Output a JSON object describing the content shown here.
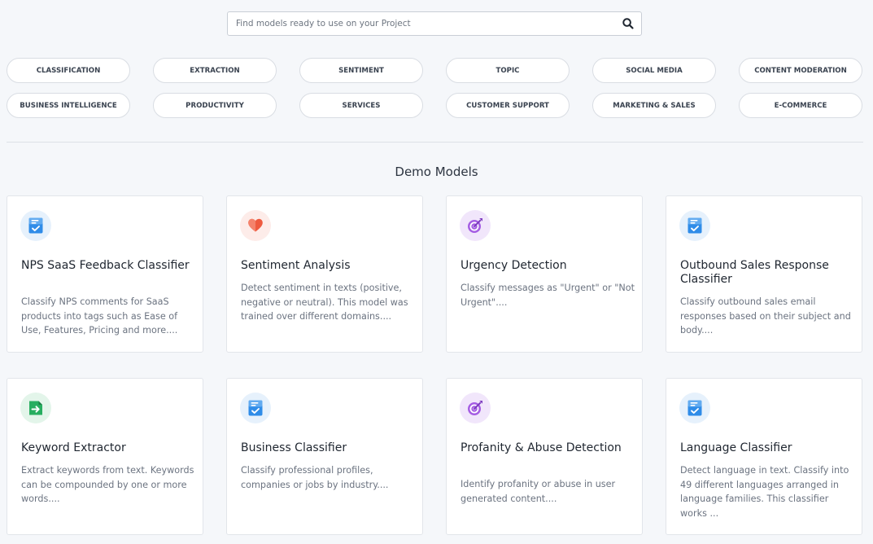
{
  "search": {
    "placeholder": "Find models ready to use on your Project",
    "value": ""
  },
  "categories": [
    "CLASSIFICATION",
    "EXTRACTION",
    "SENTIMENT",
    "TOPIC",
    "SOCIAL MEDIA",
    "CONTENT MODERATION",
    "BUSINESS INTELLIGENCE",
    "PRODUCTIVITY",
    "SERVICES",
    "CUSTOMER SUPPORT",
    "MARKETING & SALES",
    "E-COMMERCE"
  ],
  "section": {
    "title": "Demo Models"
  },
  "colors": {
    "icon_blue": "#2f8ce8",
    "icon_red": "#ee5a3f",
    "icon_purple": "#a55de3",
    "icon_green": "#27ae60"
  },
  "models": [
    {
      "title": "NPS SaaS Feedback Classifier",
      "description": "Classify NPS comments for SaaS products into tags such as Ease of Use, Features, Pricing and more....",
      "icon": "classifier-icon"
    },
    {
      "title": "Sentiment Analysis",
      "description": "Detect sentiment in texts (positive, negative or neutral). This model was trained over different domains....",
      "icon": "heart-icon"
    },
    {
      "title": "Urgency Detection",
      "description": "Classify messages as \"Urgent\" or \"Not Urgent\"....",
      "icon": "target-icon"
    },
    {
      "title": "Outbound Sales Response Classifier",
      "description": "Classify outbound sales email responses based on their subject and body....",
      "icon": "classifier-icon"
    },
    {
      "title": "Keyword Extractor",
      "description": "Extract keywords from text. Keywords can be compounded by one or more words....",
      "icon": "extractor-icon"
    },
    {
      "title": "Business Classifier",
      "description": "Classify professional profiles, companies or jobs by industry....",
      "icon": "classifier-icon"
    },
    {
      "title": "Profanity & Abuse Detection",
      "description": "Identify profanity or abuse in user generated content....",
      "icon": "target-icon"
    },
    {
      "title": "Language Classifier",
      "description": "Detect language in text. Classify into 49 different languages arranged in language families. This classifier works ...",
      "icon": "classifier-icon"
    }
  ]
}
